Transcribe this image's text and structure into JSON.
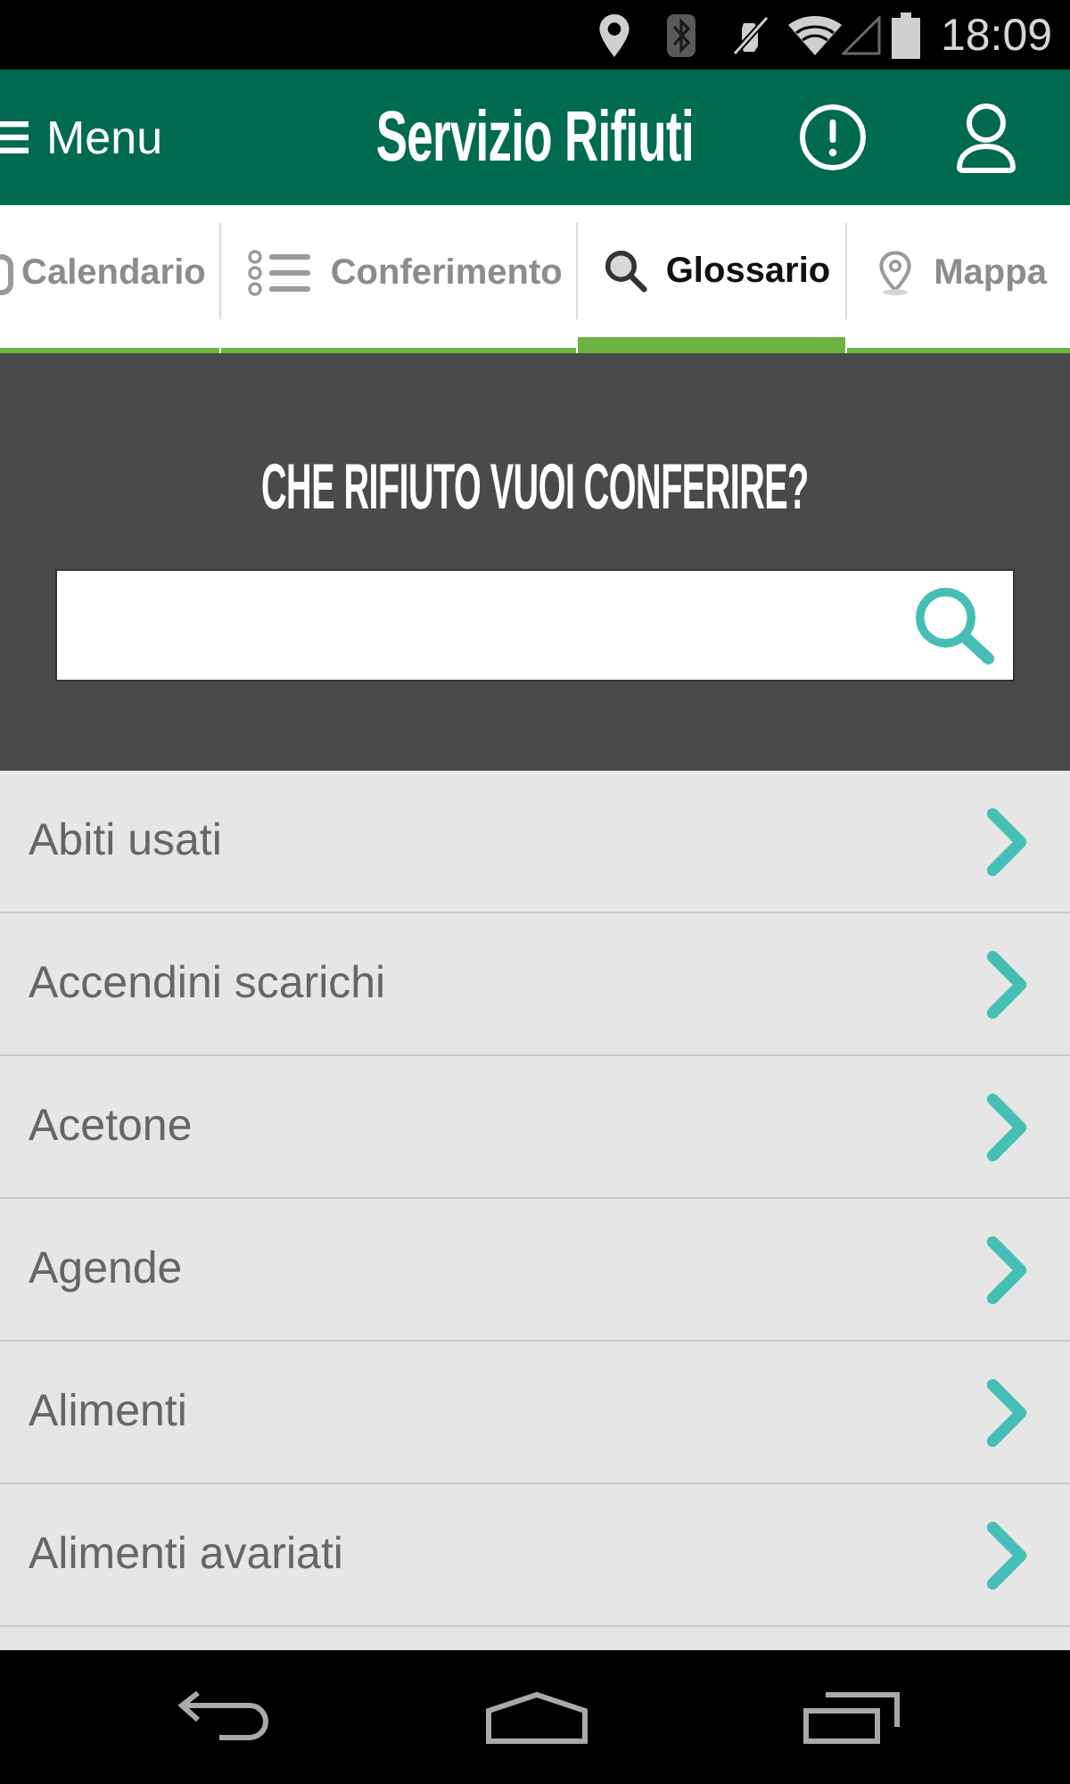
{
  "status_bar": {
    "time": "18:09"
  },
  "app_bar": {
    "menu_label": "Menu",
    "title": "Servizio Rifiuti"
  },
  "tabs": [
    {
      "label": "Calendario",
      "selected": false
    },
    {
      "label": "Conferimento",
      "selected": false
    },
    {
      "label": "Glossario",
      "selected": true
    },
    {
      "label": "Mappa",
      "selected": false
    }
  ],
  "search": {
    "heading": "CHE RIFIUTO VUOI CONFERIRE?"
  },
  "glossary": {
    "items": [
      "Abiti usati",
      "Accendini scarichi",
      "Acetone",
      "Agende",
      "Alimenti",
      "Alimenti avariati"
    ]
  }
}
